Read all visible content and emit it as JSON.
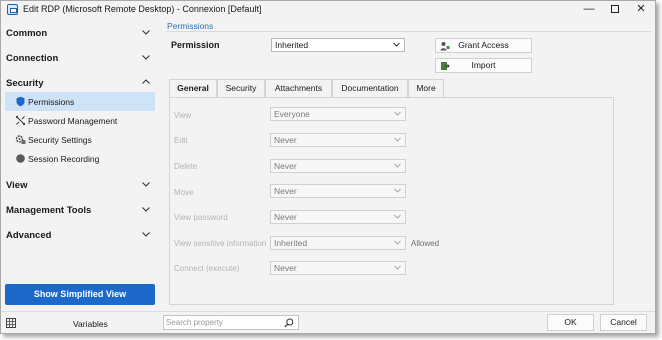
{
  "window": {
    "title": "Edit RDP (Microsoft Remote Desktop) - Connexion [Default]",
    "controls": {
      "minimize": "—",
      "close": "✕"
    }
  },
  "sidebar": {
    "categories": {
      "common": "Common",
      "connection": "Connection",
      "security": "Security",
      "view": "View",
      "management_tools": "Management Tools",
      "advanced": "Advanced"
    },
    "security_items": [
      {
        "label": "Permissions",
        "icon": "shield-icon",
        "selected": true
      },
      {
        "label": "Password Management",
        "icon": "password-management-icon",
        "selected": false
      },
      {
        "label": "Security Settings",
        "icon": "security-settings-icon",
        "selected": false
      },
      {
        "label": "Session Recording",
        "icon": "record-icon",
        "selected": false
      }
    ],
    "simplified_button": "Show Simplified View"
  },
  "main": {
    "breadcrumb": "Permissions",
    "permission_label": "Permission",
    "permission_value": "Inherited",
    "grant_access": "Grant Access",
    "import": "Import",
    "tabs": [
      "General",
      "Security",
      "Attachments",
      "Documentation",
      "More"
    ],
    "active_tab": "General",
    "rows": [
      {
        "label": "View",
        "value": "Everyone",
        "note": ""
      },
      {
        "label": "Edit",
        "value": "Never",
        "note": ""
      },
      {
        "label": "Delete",
        "value": "Never",
        "note": ""
      },
      {
        "label": "Move",
        "value": "Never",
        "note": ""
      },
      {
        "label": "View password",
        "value": "Never",
        "note": ""
      },
      {
        "label": "View sensitive information",
        "value": "Inherited",
        "note": "Allowed"
      },
      {
        "label": "Connect (execute)",
        "value": "Never",
        "note": ""
      }
    ]
  },
  "footer": {
    "variables": "Variables",
    "search_placeholder": "Search property",
    "ok": "OK",
    "cancel": "Cancel"
  },
  "colors": {
    "accent": "#1c69c9",
    "selected_bg": "#cfe3f8",
    "breadcrumb": "#2a6fba"
  }
}
